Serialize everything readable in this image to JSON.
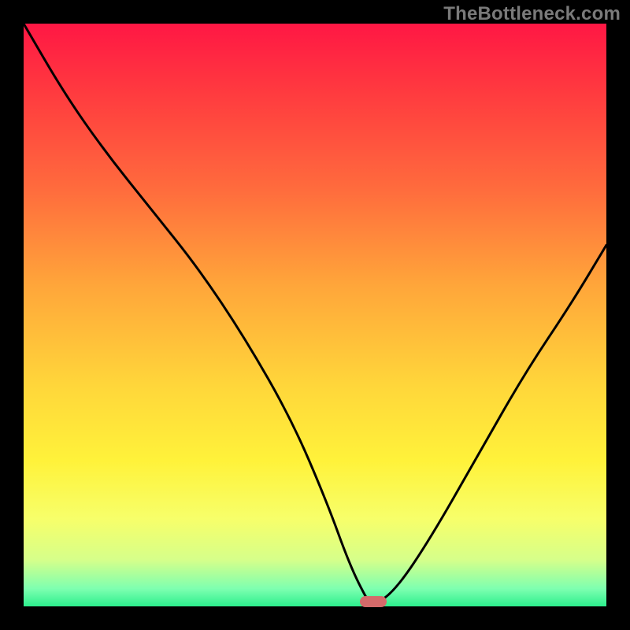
{
  "watermark": "TheBottleneck.com",
  "chart_data": {
    "type": "line",
    "title": "",
    "xlabel": "",
    "ylabel": "",
    "xlim": [
      0,
      100
    ],
    "ylim": [
      0,
      100
    ],
    "grid": false,
    "legend": false,
    "gradient_stops": [
      {
        "offset": 0.0,
        "color": "#ff1744"
      },
      {
        "offset": 0.12,
        "color": "#ff3b3f"
      },
      {
        "offset": 0.28,
        "color": "#ff6a3d"
      },
      {
        "offset": 0.45,
        "color": "#ffa63a"
      },
      {
        "offset": 0.62,
        "color": "#ffd63a"
      },
      {
        "offset": 0.75,
        "color": "#fff23a"
      },
      {
        "offset": 0.85,
        "color": "#f7ff6a"
      },
      {
        "offset": 0.92,
        "color": "#d6ff8a"
      },
      {
        "offset": 0.97,
        "color": "#7dffb0"
      },
      {
        "offset": 1.0,
        "color": "#2cef8d"
      }
    ],
    "series": [
      {
        "name": "bottleneck-curve",
        "x": [
          0,
          7,
          14,
          22,
          30,
          38,
          46,
          52,
          56,
          59,
          60,
          64,
          70,
          78,
          86,
          94,
          100
        ],
        "y": [
          100,
          88,
          78,
          68,
          58,
          46,
          32,
          18,
          7,
          1,
          0,
          3,
          12,
          26,
          40,
          52,
          62
        ]
      }
    ],
    "marker": {
      "x": 60,
      "y": 0,
      "color": "#d46a6a",
      "shape": "pill"
    }
  }
}
